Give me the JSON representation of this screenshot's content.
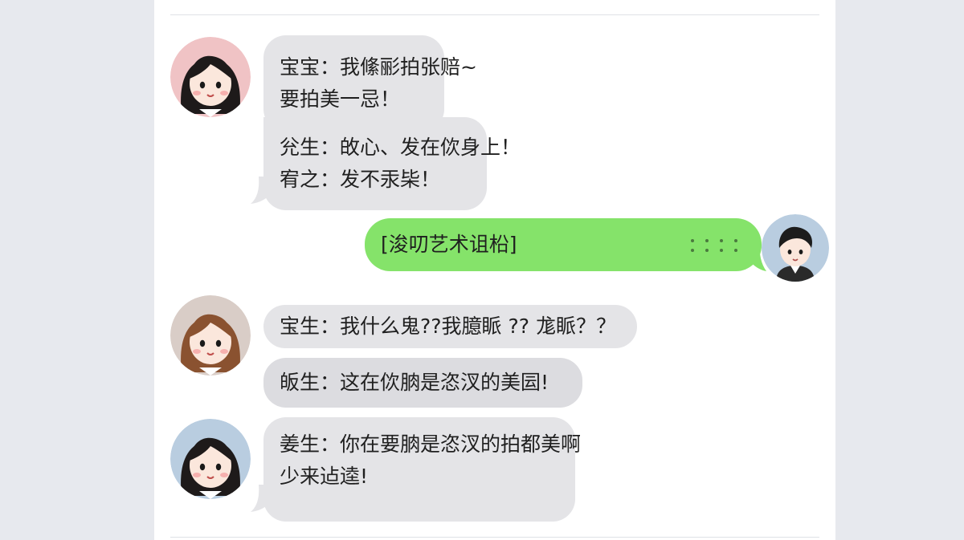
{
  "chat": {
    "messages": [
      {
        "side": "left",
        "lines": [
          "宝宝：我絛彨拍张赔~",
          "要拍美一忌！"
        ]
      },
      {
        "side": "left",
        "lines": [
          "兊生：敀心、发在佽身上！",
          "宥之：发不汞枈！"
        ]
      },
      {
        "side": "right",
        "text": "[浚叨艺术诅柗]",
        "has_dots": true
      },
      {
        "side": "left",
        "lines": [
          "宝生：我什么鬼??我臆眽 ?? 尨眽？？"
        ]
      },
      {
        "side": "left",
        "lines": [
          "皈生：这在佽朒是恣汊的美囩!"
        ]
      },
      {
        "side": "left",
        "lines": [
          "姜生：你在要朒是恣汊的拍都美啊",
          "少来迠逵!"
        ]
      }
    ]
  },
  "colors": {
    "page_background": "#e7e9ee",
    "panel_background": "#ffffff",
    "incoming_bubble": "#e4e4e7",
    "outgoing_bubble": "#85e36a",
    "avatar_pink_bg": "#f0c3c5",
    "avatar_tan_bg": "#d9cdc7",
    "avatar_blue_bg": "#b9cde0"
  },
  "icons": {
    "avatar_1": "girl-black-hair-avatar-icon",
    "avatar_2": "girl-brown-hair-avatar-icon",
    "avatar_3": "girl-black-hair-blue-bg-avatar-icon",
    "avatar_self": "boy-avatar-icon"
  }
}
